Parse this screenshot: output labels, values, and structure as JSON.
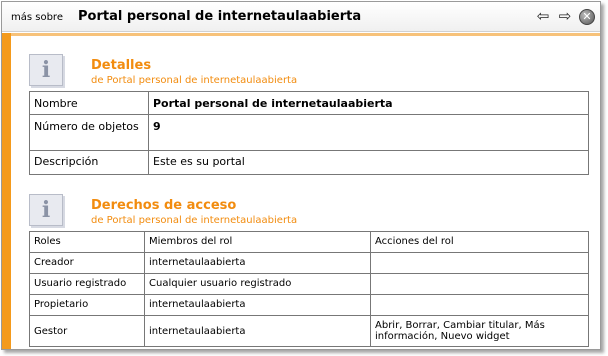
{
  "titlebar": {
    "prefix": "más sobre",
    "title": "Portal personal de internetaulaabierta",
    "back_glyph": "⇦",
    "forward_glyph": "⇨",
    "close_glyph": "✕"
  },
  "details": {
    "icon": "info-icon",
    "title": "Detalles",
    "subtitle": "de Portal personal de internetaulaabierta",
    "rows": [
      {
        "key": "Nombre",
        "value": "Portal personal de internetaulaabierta"
      },
      {
        "key": "Número de objetos",
        "value": "9"
      },
      {
        "key": "Descripción",
        "value": "Este es su portal"
      }
    ]
  },
  "access": {
    "icon": "info-icon",
    "title": "Derechos de acceso",
    "subtitle": "de Portal personal de internetaulaabierta",
    "headers": [
      "Roles",
      "Miembros del rol",
      "Acciones del rol"
    ],
    "rows": [
      {
        "role": "Creador",
        "members": "internetaulaabierta",
        "actions": ""
      },
      {
        "role": "Usuario registrado",
        "members": "Cualquier usuario registrado",
        "actions": ""
      },
      {
        "role": "Propietario",
        "members": "internetaulaabierta",
        "actions": ""
      },
      {
        "role": "Gestor",
        "members": "internetaulaabierta",
        "actions": "Abrir, Borrar, Cambiar titular, Más información, Nuevo widget"
      }
    ]
  },
  "colors": {
    "accent": "#f28c0f",
    "sidebar": "#f49a1c"
  }
}
